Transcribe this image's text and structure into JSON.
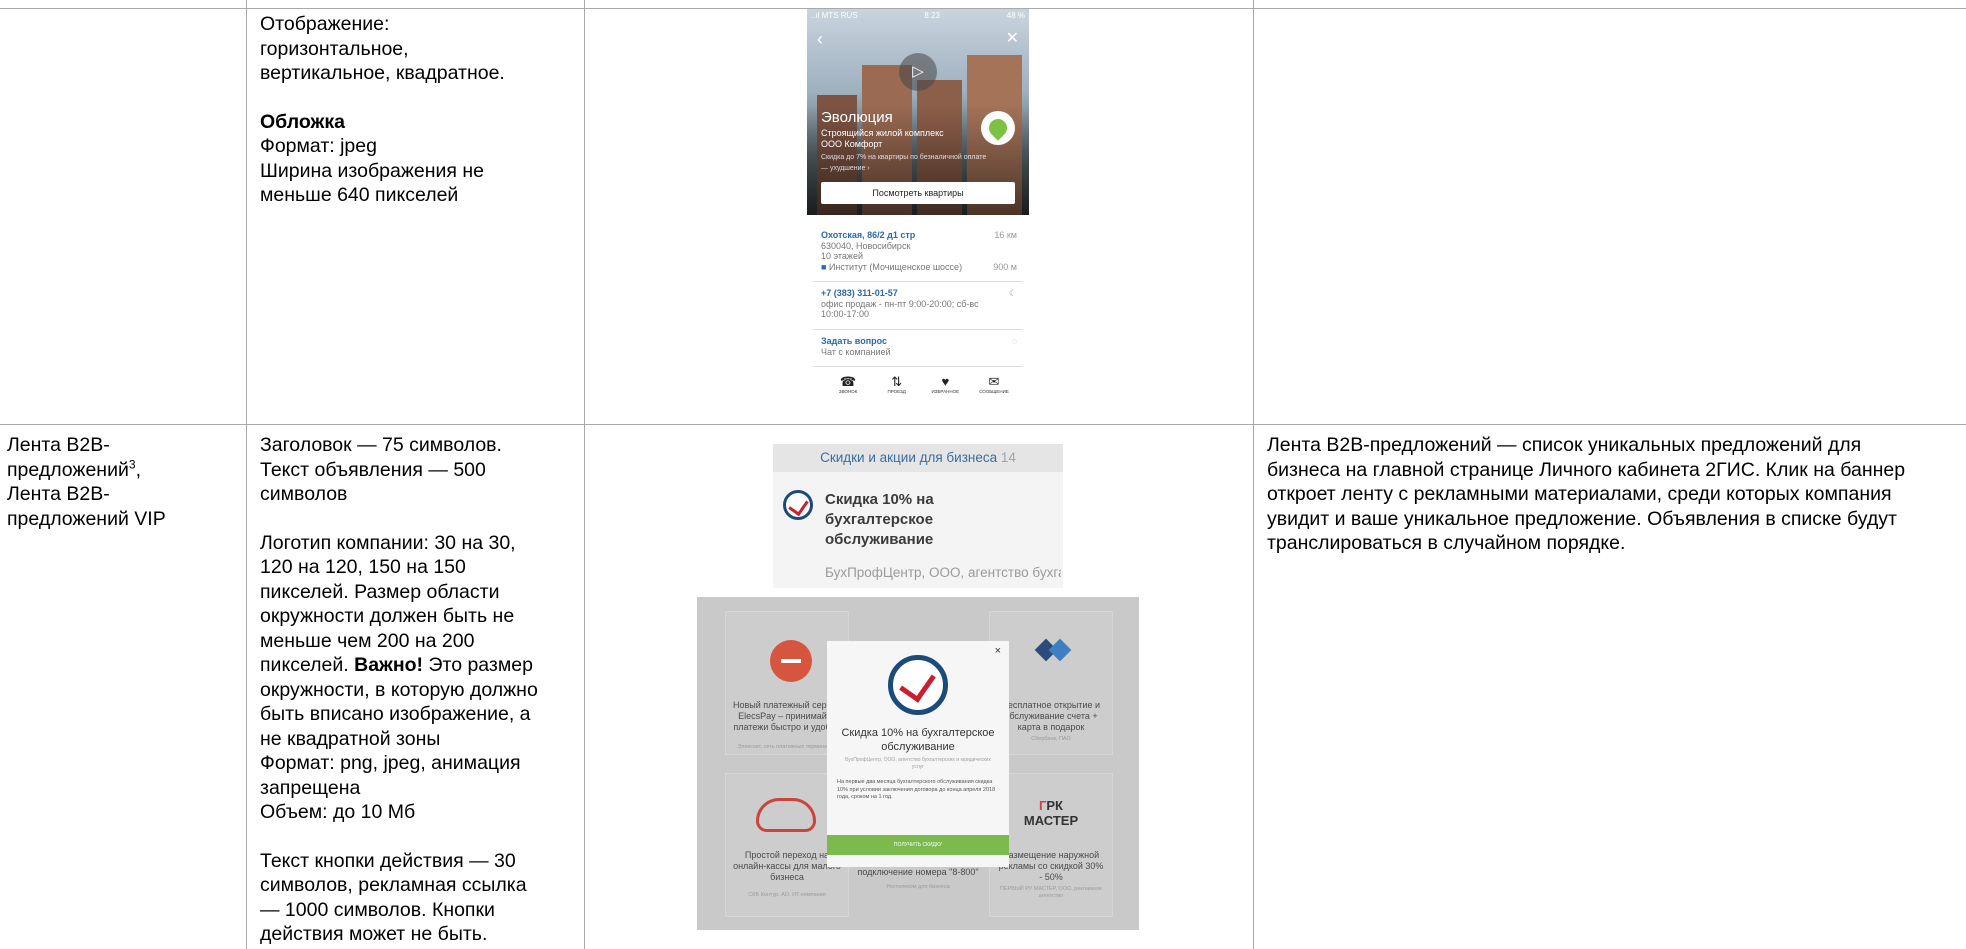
{
  "row1": {
    "requirements": [
      "Отображение:",
      "горизонтальное,",
      "вертикальное, квадратное.",
      "",
      "Обложка",
      "Формат: jpeg",
      "Ширина изображения не",
      "меньше 640 пикселей"
    ],
    "phone": {
      "status_left": "..ıl MTS RUS",
      "status_time": "8:23",
      "status_right": "48 %",
      "title": "Эволюция",
      "subtitle_1": "Строящийся жилой комплекс",
      "subtitle_2": "ООО Комфорт",
      "subtitle_3": "Скидка до 7% на квартиры по безналичной оплате",
      "subtitle_more": "— ухудшение ›",
      "button": "Посмотреть квартиры",
      "address_link": "Охотская, 86/2 д1 стр",
      "address_distance": "16 км",
      "address_city": "630040, Новосибирск",
      "address_floors": "10 этажей",
      "stop": "Институт (Мочищенское шоссе)",
      "stop_distance": "900 м",
      "phone_link": "+7 (383) 311-01-57",
      "hours_1": "офис продаж - пн-пт 9:00-20:00; сб-вс",
      "hours_2": "10:00-17:00",
      "ask_link": "Задать вопрос",
      "ask_sub": "Чат с компанией",
      "tabs": [
        {
          "icon": "☎",
          "label": "ЗВОНОК"
        },
        {
          "icon": "⇅",
          "label": "ПРОЕЗД"
        },
        {
          "icon": "♥",
          "label": "ИЗБРАННОЕ"
        },
        {
          "icon": "✉",
          "label": "СООБЩЕНИЕ"
        }
      ]
    }
  },
  "row2": {
    "name_line_1": "Лента B2B-",
    "name_line_2a": "предложений",
    "name_sup": "3",
    "name_line_2b": ",",
    "name_line_3": "Лента B2B-",
    "name_line_4": "предложений VIP",
    "requirements": {
      "l1": "Заголовок — 75 символов.",
      "l2": "Текст объявления — 500",
      "l3": "символов",
      "l4": "Логотип компании: 30 на 30,",
      "l5": "120 на 120, 150 на 150",
      "l6": "пикселей. Размер области",
      "l7": "окружности должен быть не",
      "l8": "меньше чем 200 на 200",
      "l9_bold": "Важно!",
      "l9_pre": "пикселей. ",
      "l9_post": " Это размер",
      "l10": "окружности, в которую должно",
      "l11": "быть вписано изображение, а",
      "l12": "не квадратной зоны",
      "l13": "Формат: png, jpeg, анимация",
      "l14": "запрещена",
      "l15": "Объем: до 10 Мб",
      "l16": "Текст кнопки действия — 30",
      "l17": "символов, рекламная ссылка",
      "l18": "— 1000 символов. Кнопки",
      "l19": "действия может не быть."
    },
    "description": [
      "Лента B2B-предложений — список уникальных предложений для",
      "бизнеса на главной странице Личного кабинета 2ГИС. Клик на баннер",
      "откроет ленту с рекламными материалами, среди которых компания",
      "увидит и ваше уникальное предложение. Объявления в списке будут",
      "транслироваться в случайном порядке."
    ],
    "banner": {
      "header": "Скидки и акции для бизнеса",
      "count": "14",
      "title": "Скидка 10% на бухгалтерское обслуживание",
      "subtitle": "БухПрофЦентр, ООО, агентство бухгалтерских услуг"
    },
    "modal": {
      "close": "×",
      "title": "Скидка 10% на бухгалтерское обслуживание",
      "company": "БухПрофЦентр, ООО, агентство бухгалтерских и юридических услуг",
      "body": "На первые два месяца бухгалтерского обслуживания скидка 10% при условии заключения договора до конца апреля 2018 года, сроком на 1 год.",
      "button": "ПОЛУЧИТЬ СКИДКУ",
      "cards": [
        {
          "title": "Новый платежный сервис ElecsPay – принимайте платежи быстро и удобно",
          "sub": "Элекснет, сеть платежных терминалов"
        },
        {
          "title": "Бесплатное открытие и обслуживание счета + карта в подарок",
          "sub": "Сбербанк, ПАО"
        },
        {
          "title": "Простой переход на онлайн-кассы для малого бизнеса",
          "sub": "СКБ Контур, АО, ИТ-компания"
        },
        {
          "title": "Размещение наружной рекламы со скидкой 30% - 50%",
          "sub": "ПЕРВЫЙ РУ МАСТЕР, ООО, рекламное агентство"
        }
      ],
      "under_title": "подключение номера \"8-800\"",
      "under_sub": "Ростелеком для бизнеса",
      "grk_1": "Г",
      "grk_2": "РК",
      "grk_3": "МАСТЕР"
    }
  }
}
